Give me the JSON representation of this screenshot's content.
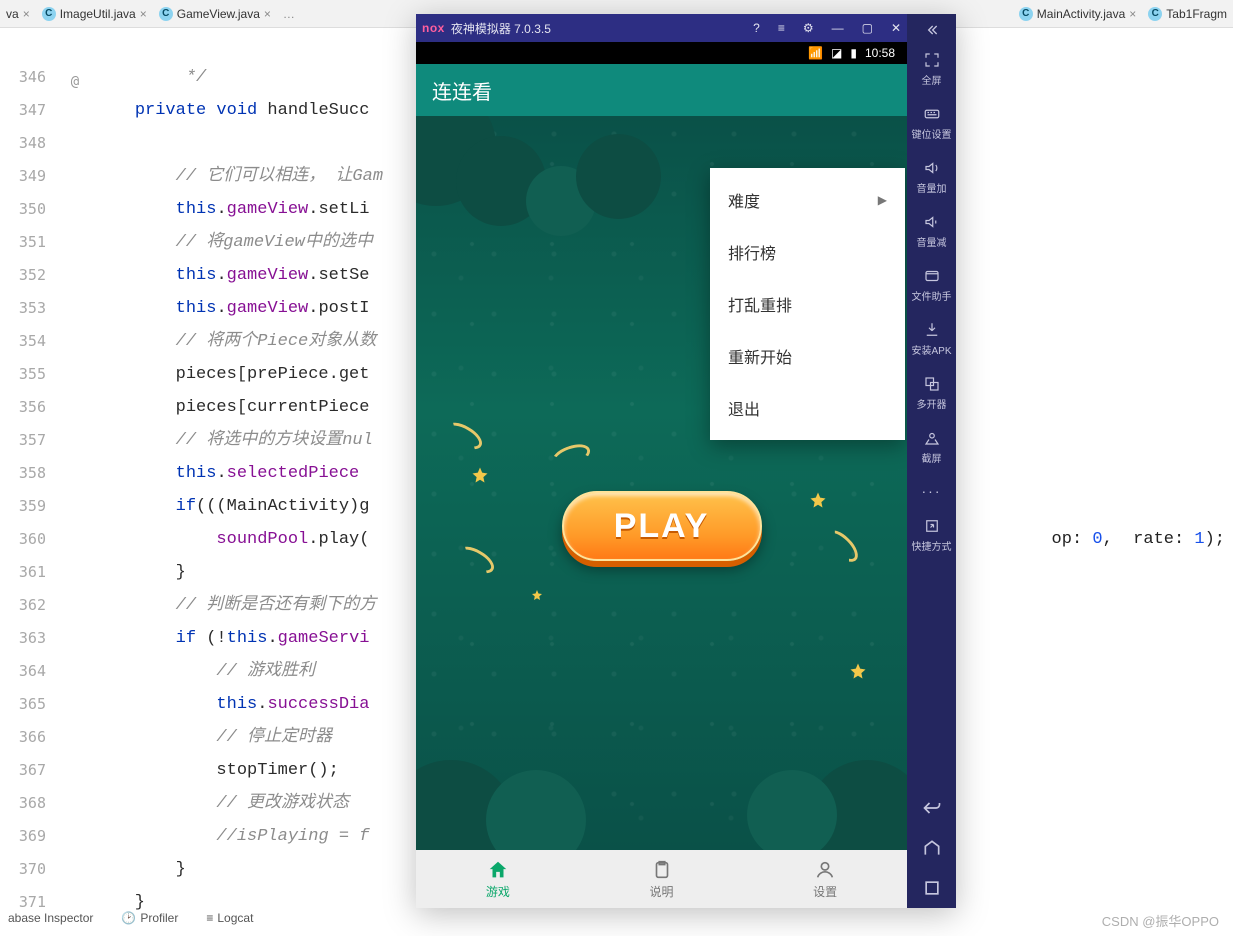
{
  "editor": {
    "tabs": [
      {
        "label": "va",
        "close": "×"
      },
      {
        "label": "ImageUtil.java",
        "close": "×"
      },
      {
        "label": "GameView.java",
        "close": "×"
      },
      {
        "label": "MainActivity.java",
        "close": "×"
      },
      {
        "label": "Tab1Fragm"
      }
    ],
    "lineStart": 346,
    "lines": [
      {
        "num": "",
        "html": ""
      },
      {
        "num": "346",
        "html": "         <span class='com'>*/</span>"
      },
      {
        "num": "347",
        "annot": "@",
        "html": "    <span class='kw'>private void</span> handleSucc"
      },
      {
        "num": "348",
        "html": ""
      },
      {
        "num": "349",
        "html": "        <span class='com'>// 它们可以相连， 让Gam</span>"
      },
      {
        "num": "350",
        "html": "        <span class='this'>this</span>.<span class='field'>gameView</span>.setLi"
      },
      {
        "num": "351",
        "html": "        <span class='com'>// 将gameView中的选中</span>"
      },
      {
        "num": "352",
        "html": "        <span class='this'>this</span>.<span class='field'>gameView</span>.setSe"
      },
      {
        "num": "353",
        "html": "        <span class='this'>this</span>.<span class='field'>gameView</span>.postI"
      },
      {
        "num": "354",
        "html": "        <span class='com'>// 将两个Piece对象从数</span>"
      },
      {
        "num": "355",
        "html": "        pieces[prePiece.get"
      },
      {
        "num": "356",
        "html": "        pieces[currentPiece"
      },
      {
        "num": "357",
        "html": "        <span class='com'>// 将选中的方块设置nul</span>"
      },
      {
        "num": "358",
        "html": "        <span class='this'>this</span>.<span class='field'>selectedPiece</span>"
      },
      {
        "num": "359",
        "html": "        <span class='kw'>if</span>(((MainActivity)g"
      },
      {
        "num": "360",
        "html": "            <span class='field'>soundPool</span>.play(",
        "right": "op: <span class='num'>0</span>,  rate: <span class='num'>1</span>);"
      },
      {
        "num": "361",
        "html": "        }"
      },
      {
        "num": "362",
        "html": "        <span class='com'>// 判断是否还有剩下的方</span>"
      },
      {
        "num": "363",
        "html": "        <span class='kw'>if</span> (!<span class='this'>this</span>.<span class='field'>gameServi</span>"
      },
      {
        "num": "364",
        "html": "            <span class='com'>// 游戏胜利</span>"
      },
      {
        "num": "365",
        "html": "            <span class='this'>this</span>.<span class='field'>successDia</span>"
      },
      {
        "num": "366",
        "html": "            <span class='com'>// 停止定时器</span>"
      },
      {
        "num": "367",
        "html": "            stopTimer();"
      },
      {
        "num": "368",
        "html": "            <span class='com'>// 更改游戏状态</span>"
      },
      {
        "num": "369",
        "html": "            <span class='com'>//isPlaying = f</span>"
      },
      {
        "num": "370",
        "html": "        }"
      },
      {
        "num": "371",
        "html": "    }"
      }
    ],
    "bottom": [
      "abase Inspector",
      "Profiler",
      "Logcat"
    ]
  },
  "emulator": {
    "logo": "nox",
    "title": "夜神模拟器 7.0.3.5",
    "time": "10:58",
    "appTitle": "连连看",
    "playLabel": "PLAY",
    "menu": [
      {
        "label": "难度",
        "caret": true
      },
      {
        "label": "排行榜"
      },
      {
        "label": "打乱重排"
      },
      {
        "label": "重新开始"
      },
      {
        "label": "退出"
      }
    ],
    "bottomnav": [
      {
        "label": "游戏",
        "active": true
      },
      {
        "label": "说明"
      },
      {
        "label": "设置"
      }
    ],
    "sidebar": [
      {
        "label": "全屏"
      },
      {
        "label": "键位设置"
      },
      {
        "label": "音量加"
      },
      {
        "label": "音量减"
      },
      {
        "label": "文件助手"
      },
      {
        "label": "安装APK"
      },
      {
        "label": "多开器"
      },
      {
        "label": "截屏"
      },
      {
        "label": "···"
      },
      {
        "label": "快捷方式"
      }
    ]
  },
  "watermark": "CSDN @振华OPPO"
}
